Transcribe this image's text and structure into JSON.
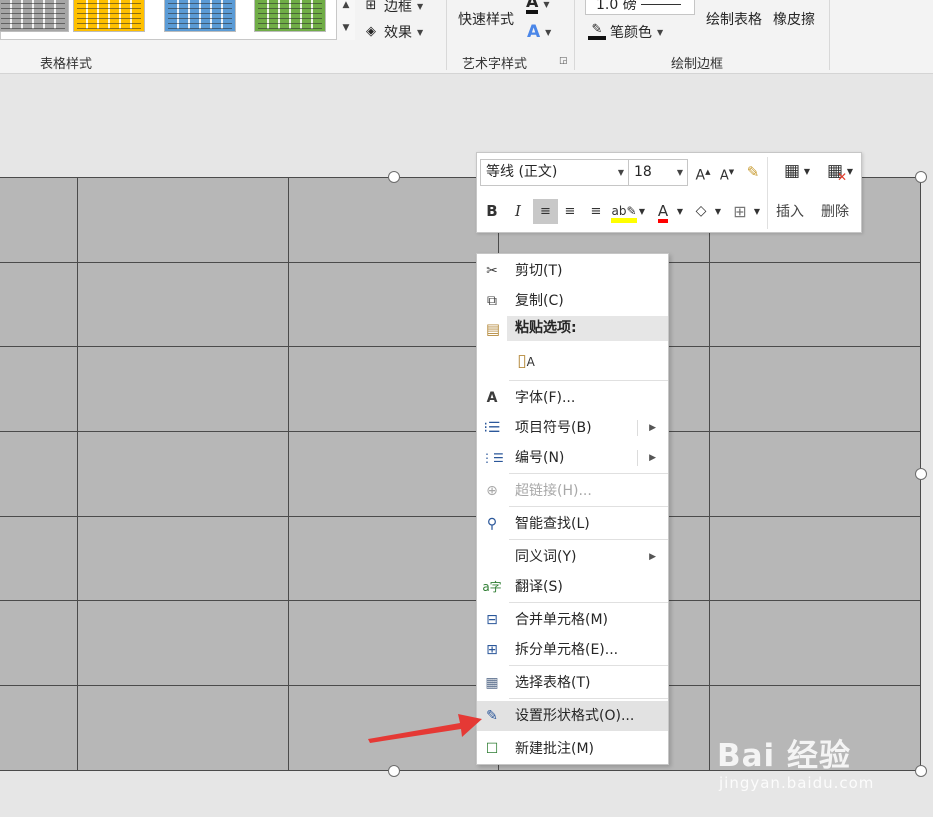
{
  "ribbon": {
    "table_styles_label": "表格样式",
    "borders_label": "边框",
    "effects_label": "效果",
    "quick_styles_label": "快速样式",
    "wordart_label": "艺术字样式",
    "pen_weight_value": "1.0 磅",
    "pen_color_label": "笔颜色",
    "draw_table_label": "绘制表格",
    "eraser_label": "橡皮擦",
    "draw_borders_label": "绘制边框",
    "style_colors": [
      "#a6a6a6",
      "#ffc000",
      "#5b9bd5",
      "#70ad47"
    ]
  },
  "mini_toolbar": {
    "font_name": "等线 (正文)",
    "font_size": "18",
    "insert_label": "插入",
    "delete_label": "删除",
    "bold": "B",
    "italic": "I",
    "font_color_glyph": "A",
    "highlight_color": "#ffff00",
    "font_color": "#ff0000"
  },
  "context_menu": {
    "items": [
      {
        "label": "剪切(T)",
        "icon": "scissors-icon"
      },
      {
        "label": "复制(C)",
        "icon": "copy-icon"
      },
      {
        "label": "粘贴选项:",
        "icon": "paste-icon"
      },
      {
        "label": "字体(F)...",
        "icon": "font-icon"
      },
      {
        "label": "项目符号(B)",
        "icon": "bullets-icon"
      },
      {
        "label": "编号(N)",
        "icon": "numbering-icon"
      },
      {
        "label": "超链接(H)...",
        "icon": "hyperlink-icon",
        "disabled": true
      },
      {
        "label": "智能查找(L)",
        "icon": "smart-lookup-icon"
      },
      {
        "label": "同义词(Y)",
        "icon": ""
      },
      {
        "label": "翻译(S)",
        "icon": "translate-icon"
      },
      {
        "label": "合并单元格(M)",
        "icon": "merge-cells-icon"
      },
      {
        "label": "拆分单元格(E)...",
        "icon": "split-cells-icon"
      },
      {
        "label": "选择表格(T)",
        "icon": "select-table-icon"
      },
      {
        "label": "设置形状格式(O)...",
        "icon": "format-shape-icon"
      },
      {
        "label": "新建批注(M)",
        "icon": "new-comment-icon"
      }
    ]
  },
  "watermark": {
    "brand": "Bai 经验",
    "site": "jingyan.baidu.com"
  }
}
